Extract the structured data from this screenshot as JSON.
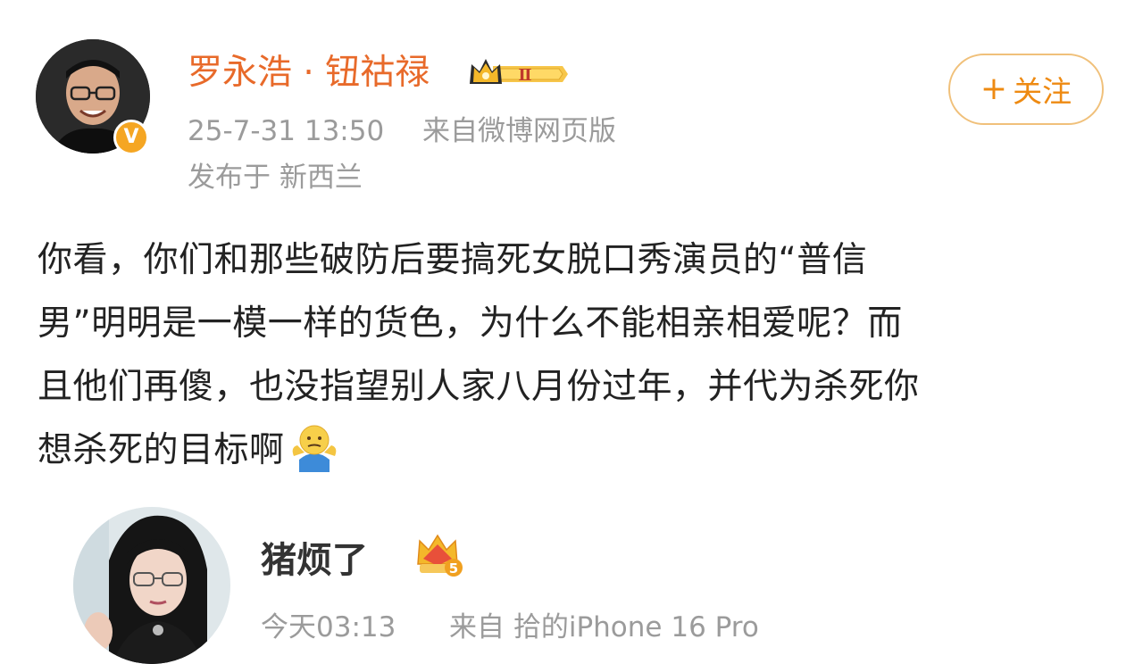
{
  "post": {
    "author": {
      "name": "罗永浩 · 钮祜禄",
      "verified_badge": "V",
      "level_badge": "Ⅱ",
      "avatar": "man-with-glasses-avatar"
    },
    "timestamp": "25-7-31 13:50",
    "source": "来自微博网页版",
    "location": "发布于 新西兰",
    "follow_button": {
      "plus": "+",
      "label": "关注"
    },
    "content_lines": [
      "你看，你们和那些破防后要搞死女脱口秀演员的“普信",
      "男”明明是一模一样的货色，为什么不能相亲相爱呢？而",
      "且他们再傻，也没指望别人家八月份过年，并代为杀死你",
      "想杀死的目标啊"
    ],
    "emoji": "shrug-emoji"
  },
  "reply": {
    "author": {
      "name": "猪烦了",
      "level_badge": "5",
      "avatar": "woman-with-glasses-avatar"
    },
    "timestamp": "今天03:13",
    "source": "来自 拾的iPhone 16 Pro"
  },
  "colors": {
    "author_name": "#e86a2a",
    "follow_text": "#ee8a12",
    "follow_border": "#f0c07a",
    "meta_text": "#9b9b9b",
    "body_text": "#222222",
    "verified_badge": "#f5a623"
  }
}
